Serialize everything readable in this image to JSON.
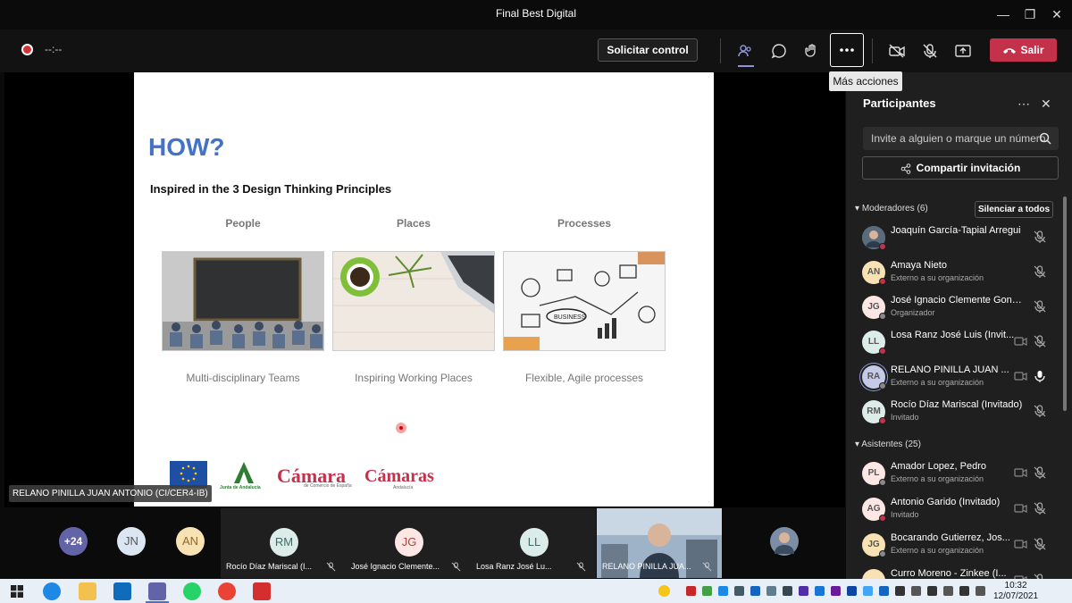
{
  "window": {
    "title": "Final Best Digital",
    "minimize": "—",
    "maximize": "❐",
    "close": "✕"
  },
  "toolbar": {
    "timer": "--:--",
    "request_control": "Solicitar control",
    "leave": "Salir",
    "more_tooltip": "Más acciones"
  },
  "slide": {
    "title": "HOW?",
    "subtitle": "Inspired in the 3 Design Thinking Principles",
    "columns": [
      {
        "head": "People",
        "caption": "Multi-disciplinary Teams"
      },
      {
        "head": "Places",
        "caption": "Inspiring Working Places"
      },
      {
        "head": "Processes",
        "caption": "Flexible, Agile processes"
      }
    ],
    "logos": {
      "eu": "UNIÓN EUROPEA",
      "junta": "Junta de Andalucía",
      "camara": "Cámara",
      "camara_sub": "de Comercio de España",
      "camaras": "Cámaras",
      "camaras_sub": "Andalucía"
    }
  },
  "presenter_tag": "RELANO PINILLA JUAN ANTONIO (CI/CER4-IB)",
  "panel": {
    "title": "Participantes",
    "search_placeholder": "Invite a alguien o marque un número",
    "share": "Compartir invitación",
    "moderators_label": "Moderadores (6)",
    "mute_all": "Silenciar a todos",
    "attendees_label": "Asistentes (25)",
    "moderators": [
      {
        "initials": "",
        "name": "Joaquín García-Tapial Arregui",
        "sub": "",
        "color": "#5a6b7c"
      },
      {
        "initials": "AN",
        "name": "Amaya Nieto",
        "sub": "Externo a su organización",
        "color": "#f8e2b4"
      },
      {
        "initials": "JG",
        "name": "José Ignacio Clemente Gonzál...",
        "sub": "Organizador",
        "color": "#fde7e4"
      },
      {
        "initials": "LL",
        "name": "Losa Ranz José Luis (Invit...",
        "sub": "",
        "color": "#dcece9"
      },
      {
        "initials": "RA",
        "name": "RELANO PINILLA JUAN ...",
        "sub": "Externo a su organización",
        "color": "#c5cbe6"
      },
      {
        "initials": "RM",
        "name": "Rocío Díaz Mariscal (Invitado)",
        "sub": "Invitado",
        "color": "#dcece9"
      }
    ],
    "attendees": [
      {
        "initials": "PL",
        "name": "Amador Lopez, Pedro",
        "sub": "Externo a su organización",
        "color": "#fde7e4"
      },
      {
        "initials": "AG",
        "name": "Antonio Garido (Invitado)",
        "sub": "Invitado",
        "color": "#fde7e4"
      },
      {
        "initials": "JG",
        "name": "Bocarando Gutierrez, Jos...",
        "sub": "Externo a su organización",
        "color": "#f8e2b4"
      },
      {
        "initials": "",
        "name": "Curro Moreno - Zinkee (I...",
        "sub": "",
        "color": "#f8e2b4"
      }
    ]
  },
  "strip": {
    "overflow": "+24",
    "circles": [
      {
        "initials": "JN",
        "color": "#dce6f2",
        "fg": "#555"
      },
      {
        "initials": "AN",
        "color": "#f8e2b4",
        "fg": "#8a6a2a"
      }
    ],
    "tiles": [
      {
        "initials": "RM",
        "name": "Rocío Díaz Mariscal (I...",
        "color": "#dcece9",
        "fg": "#3d6b64"
      },
      {
        "initials": "JG",
        "name": "José Ignacio Clemente...",
        "color": "#fde7e4",
        "fg": "#a9463c"
      },
      {
        "initials": "LL",
        "name": "Losa Ranz José Lu...",
        "color": "#dcece9",
        "fg": "#3d6b64"
      },
      {
        "initials": "",
        "name": "RELANO PINILLA JUA...",
        "color": "#7c8ea6",
        "fg": "#fff"
      }
    ]
  },
  "clock": {
    "time": "10:32",
    "date": "12/07/2021"
  }
}
